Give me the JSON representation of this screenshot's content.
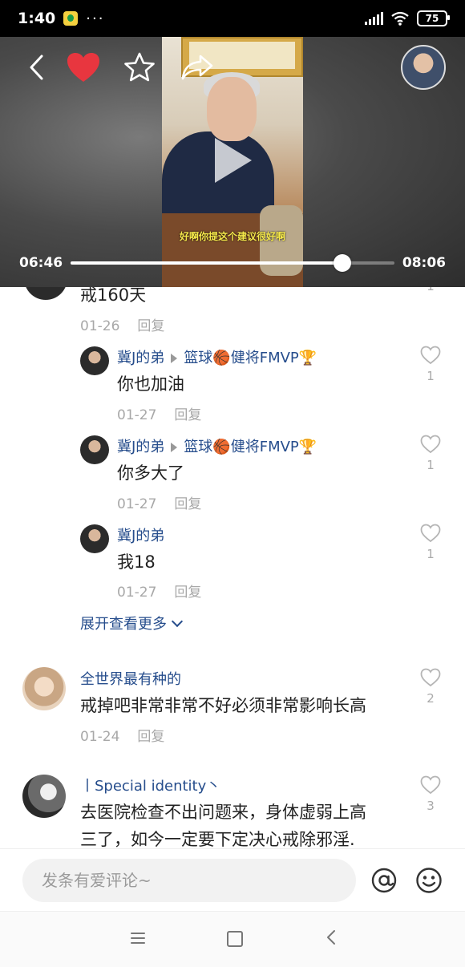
{
  "status_bar": {
    "time": "1:40",
    "dots": "···",
    "battery": "75"
  },
  "video": {
    "caption": "好啊你提这个建议很好啊",
    "current_time": "06:46",
    "total_time": "08:06",
    "progress": 0.84
  },
  "comments": {
    "partial_top": {
      "text": "戒160天",
      "date": "01-26",
      "reply_label": "回复",
      "likes": "1"
    },
    "replies": [
      {
        "user": "冀J的弟",
        "reply_to": "篮球🏀健将FMVP🏆",
        "text": "你也加油",
        "date": "01-27",
        "reply_label": "回复",
        "likes": "1"
      },
      {
        "user": "冀J的弟",
        "reply_to": "篮球🏀健将FMVP🏆",
        "text": "你多大了",
        "date": "01-27",
        "reply_label": "回复",
        "likes": "1"
      },
      {
        "user": "冀J的弟",
        "reply_to": "",
        "text": "我18",
        "date": "01-27",
        "reply_label": "回复",
        "likes": "1"
      }
    ],
    "expand_label": "展开查看更多",
    "top_level": [
      {
        "user": "全世界最有种的",
        "text": "戒掉吧非常非常不好必须非常影响长高",
        "date": "01-24",
        "reply_label": "回复",
        "likes": "2"
      },
      {
        "user": "丨Special  identity丶",
        "text_line1": "去医院检查不出问题来，身体虚弱上高",
        "text_line2": "三了，如今一定要下定决心戒除邪淫.",
        "likes": "3"
      }
    ]
  },
  "input_bar": {
    "placeholder": "发条有爱评论~"
  },
  "colors": {
    "link_blue": "#264d8c",
    "heart_red": "#e8363f",
    "meta_gray": "#a8a8a8"
  }
}
